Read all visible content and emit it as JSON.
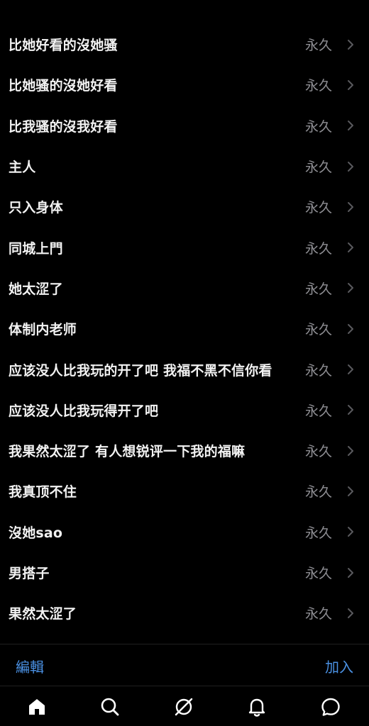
{
  "filter_list": [
    {
      "label": "比她好看的沒她骚",
      "duration": "永久"
    },
    {
      "label": "比她骚的沒她好看",
      "duration": "永久"
    },
    {
      "label": "比我骚的沒我好看",
      "duration": "永久"
    },
    {
      "label": "主人",
      "duration": "永久"
    },
    {
      "label": "只入身体",
      "duration": "永久"
    },
    {
      "label": "同城上門",
      "duration": "永久"
    },
    {
      "label": "她太涩了",
      "duration": "永久"
    },
    {
      "label": "体制内老师",
      "duration": "永久"
    },
    {
      "label": "应该没人比我玩的开了吧 我福不黑不信你看",
      "duration": "永久"
    },
    {
      "label": "应该没人比我玩得开了吧",
      "duration": "永久"
    },
    {
      "label": "我果然太涩了 有人想锐评一下我的福嘛",
      "duration": "永久"
    },
    {
      "label": "我真顶不住",
      "duration": "永久"
    },
    {
      "label": "沒她sao",
      "duration": "永久"
    },
    {
      "label": "男搭子",
      "duration": "永久"
    },
    {
      "label": "果然太涩了",
      "duration": "永久"
    }
  ],
  "action_bar": {
    "edit_label": "編輯",
    "add_label": "加入"
  },
  "tab_bar": {
    "items": [
      {
        "icon": "home-icon"
      },
      {
        "icon": "search-icon"
      },
      {
        "icon": "explore-icon"
      },
      {
        "icon": "bell-icon"
      },
      {
        "icon": "chat-icon"
      }
    ]
  },
  "colors": {
    "background": "#000000",
    "text": "#f2f2f2",
    "secondary_text": "#8e8e93",
    "accent": "#4a90e2"
  }
}
